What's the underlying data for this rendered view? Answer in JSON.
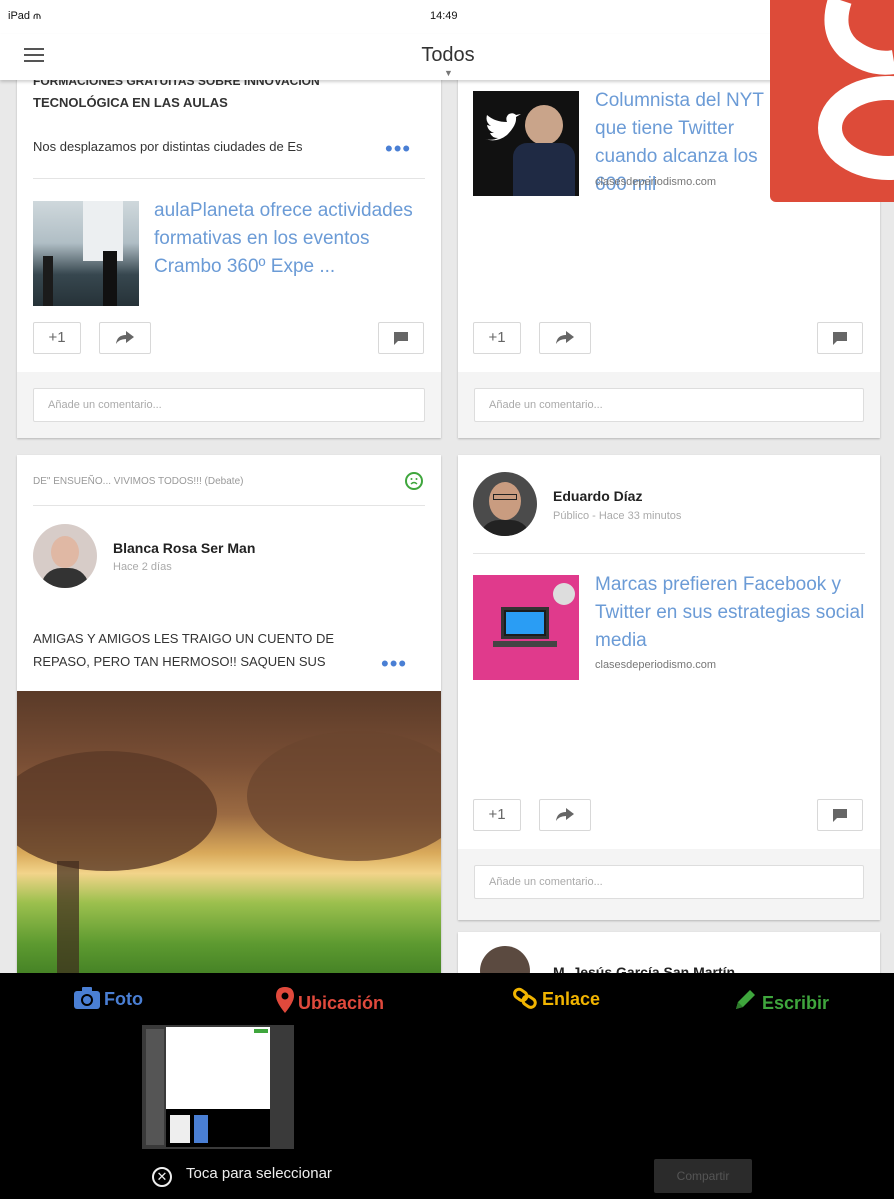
{
  "status_bar": {
    "device": "iPad",
    "time": "14:49"
  },
  "header": {
    "title": "Todos"
  },
  "posts": {
    "p1": {
      "heading_partial": "FORMACIONES GRATUITAS SOBRE INNOVACIÓN",
      "heading": "TECNOLÓGICA EN LAS AULAS",
      "text": "Nos desplazamos por distintas ciudades de Es",
      "link_title": "aulaPlaneta ofrece actividades formativas en los eventos Crambo 360º Expe ...",
      "plus_label": "+1",
      "comment_placeholder": "Añade un comentario..."
    },
    "p2": {
      "link_title": "Columnista del NYT que tiene Twitter cuando alcanza los 600 mil",
      "link_domain": "clasesdeperiodismo.com",
      "plus_label": "+1",
      "comment_placeholder": "Añade un comentario..."
    },
    "p3": {
      "community": "DE\" ENSUEÑO... VIVIMOS TODOS!!! (Debate)",
      "author": "Blanca Rosa Ser Man",
      "meta": "Hace 2 días",
      "text_line1": "AMIGAS Y AMIGOS LES TRAIGO UN CUENTO DE",
      "text_line2": "REPASO, PERO TAN HERMOSO!! SAQUEN SUS"
    },
    "p4": {
      "author": "Eduardo Díaz",
      "meta": "Público - Hace 33 minutos",
      "link_title": "Marcas prefieren Facebook y Twitter en sus estrategias social media",
      "link_domain": "clasesdeperiodismo.com",
      "plus_label": "+1",
      "comment_placeholder": "Añade un comentario..."
    },
    "p5": {
      "author": "M. Jesús García San Martín"
    }
  },
  "bottom_bar": {
    "photo": "Foto",
    "location": "Ubicación",
    "link": "Enlace",
    "write": "Escribir",
    "select_hint": "Toca para seleccionar",
    "publish": "Compartir"
  },
  "colors": {
    "accent_blue": "#4a7fd4",
    "link_blue": "#6b9bd6",
    "gplus_red": "#dd4b39",
    "photo_blue": "#4a7fd4",
    "location_red": "#e0493c",
    "link_yellow": "#f1b400",
    "write_green": "#3fa63d"
  },
  "icons": [
    "menu-icon",
    "plus-one-icon",
    "share-icon",
    "comment-icon",
    "camera-icon",
    "location-pin-icon",
    "link-icon",
    "pencil-icon",
    "close-circle-icon",
    "smiley-icon",
    "google-plus-logo"
  ]
}
